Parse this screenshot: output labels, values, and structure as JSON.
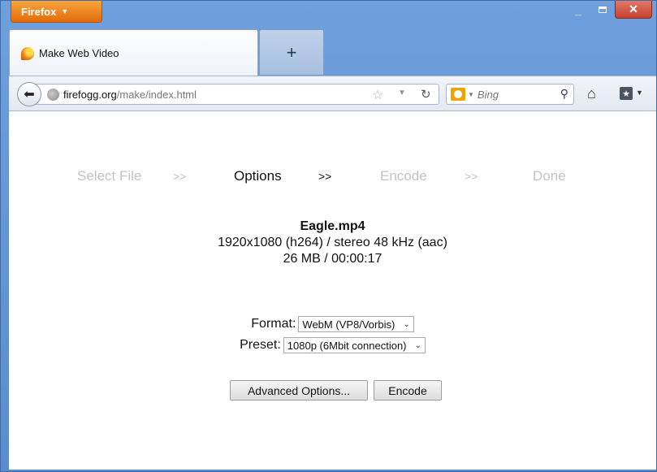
{
  "browser": {
    "menu_button": "Firefox",
    "tab_title": "Make Web Video",
    "new_tab": "+",
    "url_host": "firefogg.org",
    "url_path": "/make/index.html",
    "search_placeholder": "Bing",
    "window_controls": [
      "minimize",
      "maximize",
      "close"
    ]
  },
  "steps": {
    "select_file": "Select File",
    "options": "Options",
    "encode": "Encode",
    "done": "Done",
    "separator": ">>"
  },
  "file": {
    "name": "Eagle.mp4",
    "video_audio": "1920x1080 (h264) / stereo 48 kHz (aac)",
    "size_duration": "26 MB / 00:00:17"
  },
  "form": {
    "format_label": "Format:",
    "format_value": "WebM (VP8/Vorbis)",
    "preset_label": "Preset:",
    "preset_value": "1080p (6Mbit connection)"
  },
  "buttons": {
    "advanced": "Advanced Options...",
    "encode": "Encode"
  }
}
